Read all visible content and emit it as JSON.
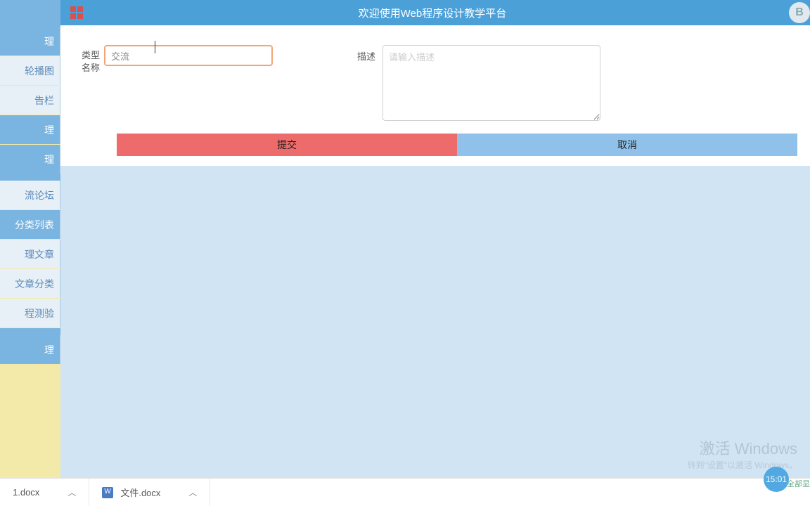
{
  "header": {
    "title": "欢迎使用Web程序设计教学平台"
  },
  "sidebar": {
    "items": [
      {
        "label": "理",
        "style": "blue"
      },
      {
        "label": "轮播图",
        "style": "light"
      },
      {
        "label": "告栏",
        "style": "light"
      },
      {
        "label": "理",
        "style": "blue"
      },
      {
        "label": "理",
        "style": "blue"
      },
      {
        "label": "流论坛",
        "style": "light"
      },
      {
        "label": "分类列表",
        "style": "blue"
      },
      {
        "label": "理文章",
        "style": "light"
      },
      {
        "label": "文章分类",
        "style": "light"
      },
      {
        "label": "程测验",
        "style": "light"
      },
      {
        "label": "理",
        "style": "blue"
      }
    ]
  },
  "form": {
    "type_name_label": "类型名称",
    "type_name_value": "交流",
    "desc_label": "描述",
    "desc_placeholder": "请输入描述",
    "submit": "提交",
    "cancel": "取消"
  },
  "taskbar": {
    "file1": "1.docx",
    "file2": "文件.docx"
  },
  "watermark": {
    "title": "激活 Windows",
    "sub": "转到\"设置\"以激活 Windows。"
  },
  "clock": "15:01",
  "showall": "全部显"
}
